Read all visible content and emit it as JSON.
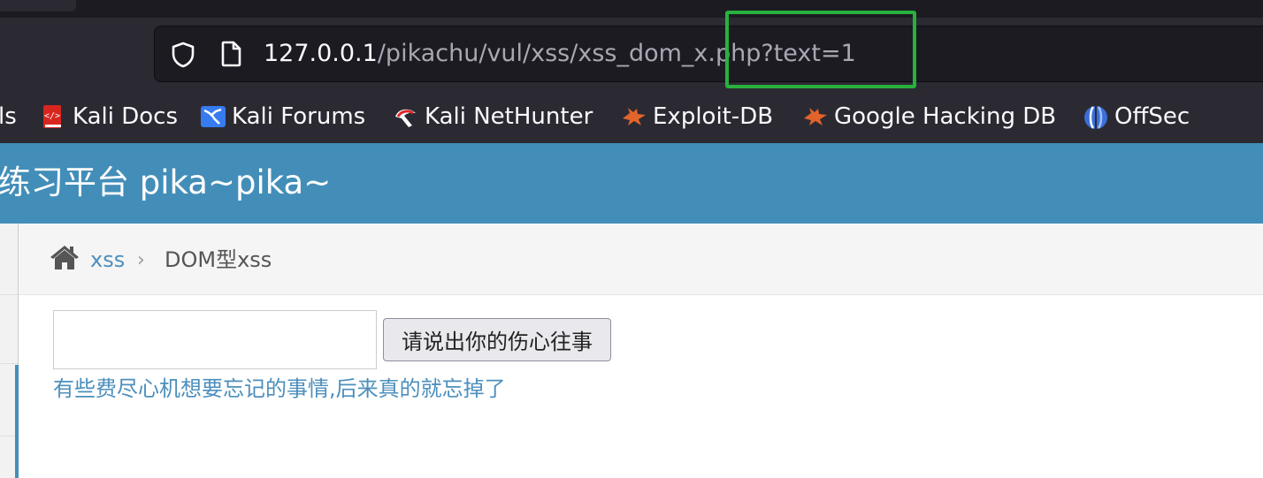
{
  "browser": {
    "url_host": "127.0.0.1",
    "url_path": "/pikachu/vul/xss/xss_dom_x.php?text=1",
    "bookmarks": [
      {
        "label": "ls",
        "icon": "bookmark-icon"
      },
      {
        "label": "Kali Docs",
        "icon": "kali-docs-icon"
      },
      {
        "label": "Kali Forums",
        "icon": "kali-forums-icon"
      },
      {
        "label": "Kali NetHunter",
        "icon": "kali-nethunter-icon"
      },
      {
        "label": "Exploit-DB",
        "icon": "exploit-db-icon"
      },
      {
        "label": "Google Hacking DB",
        "icon": "ghdb-icon"
      },
      {
        "label": "OffSec",
        "icon": "offsec-icon"
      }
    ],
    "highlight_color": "#27b13d"
  },
  "header": {
    "title": "练习平台 pika~pika~",
    "color": "#438eb9"
  },
  "breadcrumb": {
    "link": "xss",
    "separator": "›",
    "current": "DOM型xss"
  },
  "form": {
    "input_value": "",
    "button_label": "请说出你的伤心往事"
  },
  "result": {
    "link_text": "有些费尽心机想要忘记的事情,后来真的就忘掉了"
  }
}
